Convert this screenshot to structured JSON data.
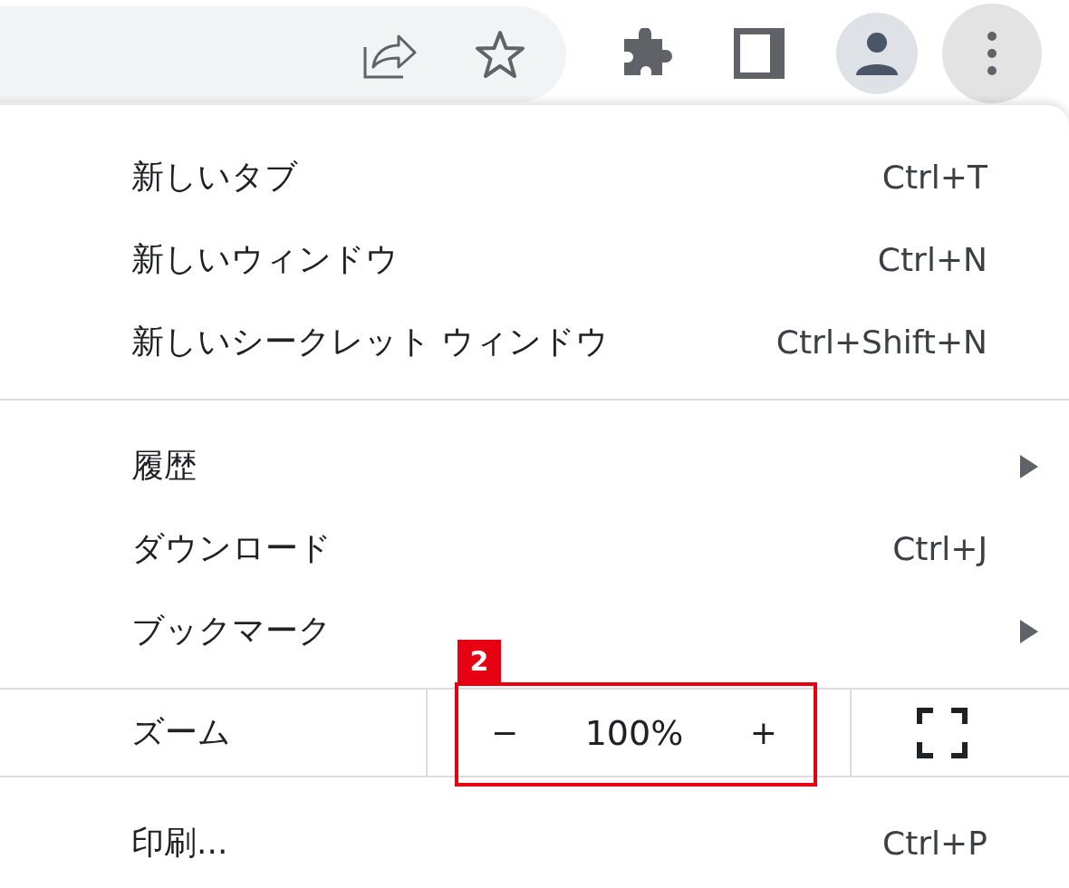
{
  "menu": {
    "sections": [
      {
        "items": [
          {
            "kind": "shortcut",
            "label": "新しいタブ",
            "shortcut": "Ctrl+T"
          },
          {
            "kind": "shortcut",
            "label": "新しいウィンドウ",
            "shortcut": "Ctrl+N"
          },
          {
            "kind": "shortcut",
            "label": "新しいシークレット ウィンドウ",
            "shortcut": "Ctrl+Shift+N"
          }
        ]
      },
      {
        "items": [
          {
            "kind": "submenu",
            "label": "履歴"
          },
          {
            "kind": "shortcut",
            "label": "ダウンロード",
            "shortcut": "Ctrl+J"
          },
          {
            "kind": "submenu",
            "label": "ブックマーク"
          }
        ]
      },
      {
        "items": [
          {
            "kind": "zoom",
            "label": "ズーム",
            "minus": "−",
            "value": "100%",
            "plus": "+"
          }
        ]
      },
      {
        "items": [
          {
            "kind": "shortcut",
            "label": "印刷...",
            "shortcut": "Ctrl+P"
          }
        ]
      }
    ]
  },
  "annotation": {
    "label": "2"
  }
}
